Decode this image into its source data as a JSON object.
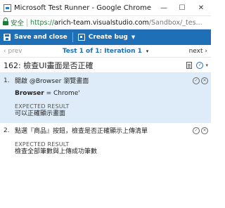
{
  "window": {
    "title": "Microsoft Test Runner - Google Chrome",
    "minimize": "—",
    "maximize": "☐",
    "close": "✕"
  },
  "address": {
    "secure_label": "安全",
    "scheme": "https://",
    "host": "arich-team.visualstudio.com",
    "path": "/Sandbox/_tes..."
  },
  "toolbar": {
    "save_close": "Save and close",
    "create_bug": "Create bug"
  },
  "nav": {
    "prev": "‹ prev",
    "iteration": "Test 1 of 1: Iteration 1",
    "next": "next ›"
  },
  "test_case": {
    "title": "162: 檢查UI畫面是否正確"
  },
  "steps": [
    {
      "number": "1.",
      "action": "開啟 @Browser 瀏覽畫面",
      "param_name": "Browser",
      "param_value": " = Chrome'",
      "expected_label": "EXPECTED RESULT",
      "expected_text": "可以正確顯示畫面"
    },
    {
      "number": "2.",
      "action": "點選『商品』按鈕，檢查是否正確顯示上傳清單",
      "expected_label": "EXPECTED RESULT",
      "expected_text": "檢查全部筆數與上傳成功筆數"
    }
  ],
  "icons": {
    "pass": "✓",
    "fail": "✕",
    "caret": "▾",
    "caret_white": "▼"
  },
  "colors": {
    "accent": "#1e6fb5",
    "secure": "#188038",
    "selected_row": "#deecf9"
  }
}
